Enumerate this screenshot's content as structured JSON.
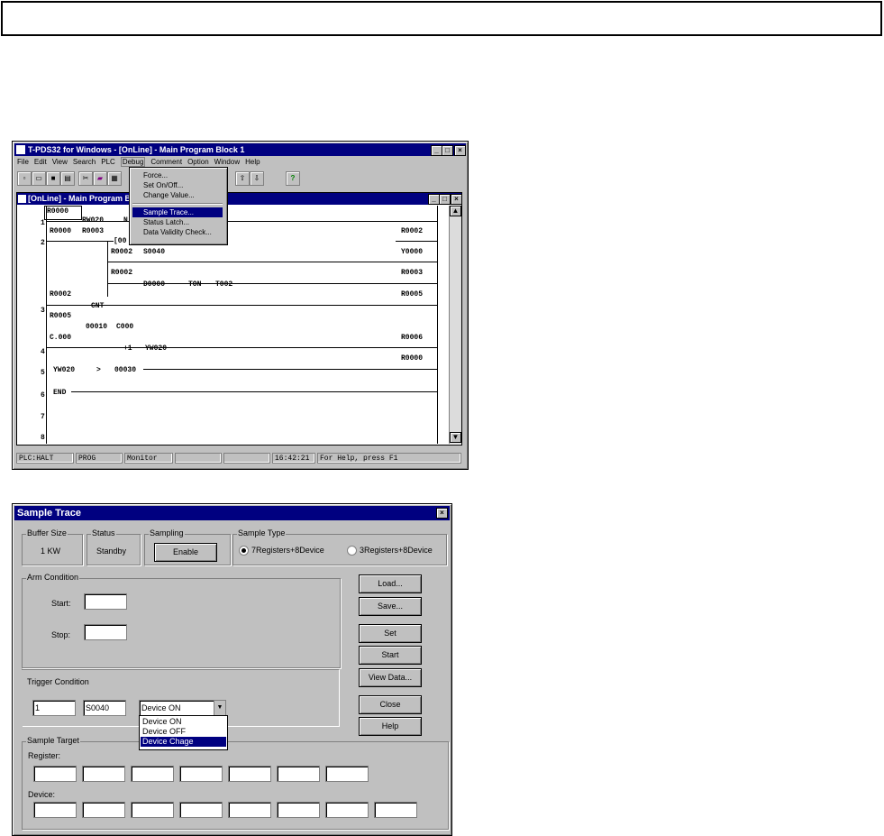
{
  "win1": {
    "title": "T-PDS32 for Windows - [OnLine] - Main Program Block 1",
    "menus": [
      "File",
      "Edit",
      "View",
      "Search",
      "PLC",
      "Debug",
      "Comment",
      "Option",
      "Window",
      "Help"
    ],
    "child_title": "[OnLine] - Main Program B",
    "debug_menu": [
      "Force...",
      "Set On/Off...",
      "Change Value...",
      "Sample Trace...",
      "Status Latch...",
      "Data Validity Check..."
    ],
    "ladder": {
      "r1a": "R0000",
      "r1b": "RW020",
      "r1c": "N",
      "r2a": "R0000",
      "r2b": "R0003",
      "r2c": "[00",
      "r2coil": "R0002",
      "r2d": "R0002",
      "r2e": "S0040",
      "r2coil2": "Y0000",
      "r2f": "R0002",
      "r2g": "D0000",
      "r2h": "TON",
      "r2i": "T002",
      "r2coil3": "R0003",
      "r3a": "R0002",
      "r3b": "CNT",
      "r3coil": "R0005",
      "r3c": "R0005",
      "r3d": "00010",
      "r3e": "C000",
      "r4a": "C.000",
      "r4b": "+1",
      "r4c": "YW020",
      "r4coil": "R0006",
      "r4coil2": "R0000",
      "r5a": "YW020",
      "r5b": ">",
      "r5c": "00030",
      "r6a": "END",
      "n1": "1",
      "n2": "2",
      "n3": "3",
      "n4": "4",
      "n5": "5",
      "n6": "6",
      "n7": "7",
      "n8": "8"
    },
    "status": [
      "PLC:HALT",
      "PROG",
      "Monitor",
      "",
      "",
      "16:42:21",
      "For Help, press F1"
    ]
  },
  "win2": {
    "title": "Sample Trace",
    "buffer_label": "Buffer Size",
    "buffer_value": "1 KW",
    "status_label": "Status",
    "status_value": "Standby",
    "sampling_label": "Sampling",
    "enable_btn": "Enable",
    "type_label": "Sample Type",
    "type_opt1": "7Registers+8Device",
    "type_opt2": "3Registers+8Device",
    "arm_label": "Arm Condition",
    "start_label": "Start:",
    "stop_label": "Stop:",
    "trigger_label": "Trigger Condition",
    "trigger_value1": "1",
    "trigger_value2": "S0040",
    "trigger_select": "Device ON",
    "trigger_options": [
      "Device ON",
      "Device OFF",
      "Device Chage"
    ],
    "target_label": "Sample Target",
    "register_label": "Register:",
    "device_label": "Device:",
    "buttons": [
      "Load...",
      "Save...",
      "Set",
      "Start",
      "View Data...",
      "Close",
      "Help"
    ]
  }
}
